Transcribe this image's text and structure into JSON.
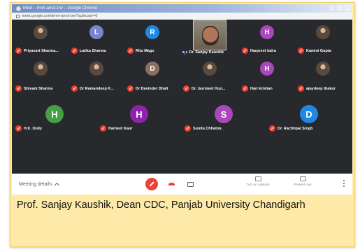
{
  "window": {
    "title": "Meet – tmm-arnd-znv – Google Chrome",
    "url": "meet.google.com/tmm-arnd-znv?authuser=0"
  },
  "colors": {
    "mic_off": "#ea4335",
    "caption_background": "#fde9a8",
    "meet_background": "#202124"
  },
  "participants": [
    {
      "name": "Priyavart Sharma...",
      "type": "photo"
    },
    {
      "name": "Latika Sharma",
      "type": "initial",
      "initial": "L",
      "color": "#7986cb"
    },
    {
      "name": "Ritu Mago",
      "type": "initial",
      "initial": "R",
      "color": "#1e88e5"
    },
    {
      "name": "Dr. Sanjay Kaushik",
      "type": "video",
      "speaking": true
    },
    {
      "name": "Harpreet kalra",
      "type": "initial",
      "initial": "H",
      "color": "#ab47bc"
    },
    {
      "name": "Kamini Gupta",
      "type": "photo"
    },
    {
      "name": "Shivani Sharma",
      "type": "photo"
    },
    {
      "name": "Dr Ramandeep K...",
      "type": "photo"
    },
    {
      "name": "Dr Davinder Dhalt",
      "type": "initial",
      "initial": "D",
      "color": "#8d6e63"
    },
    {
      "name": "Dr. Gurmeet Hun...",
      "type": "photo"
    },
    {
      "name": "Hari krishan",
      "type": "initial",
      "initial": "H",
      "color": "#ab47bc"
    },
    {
      "name": "ajaydeep thakur",
      "type": "photo"
    },
    {
      "name": "H.K. Dolly",
      "type": "initial",
      "initial": "H",
      "color": "#43a047"
    },
    {
      "name": "Harneet Kaur",
      "type": "initial",
      "initial": "H",
      "color": "#8e24aa"
    },
    {
      "name": "Sunita Chhabra",
      "type": "initial",
      "initial": "S",
      "color": "#ab47bc"
    },
    {
      "name": "Dr. Rachhpal Singh",
      "type": "initial",
      "initial": "D",
      "color": "#1e88e5"
    }
  ],
  "controls": {
    "meeting_details": "Meeting details",
    "captions": "Turn on captions",
    "present": "Present now"
  },
  "caption": "Prof. Sanjay Kaushik, Dean CDC, Panjab University Chandigarh"
}
